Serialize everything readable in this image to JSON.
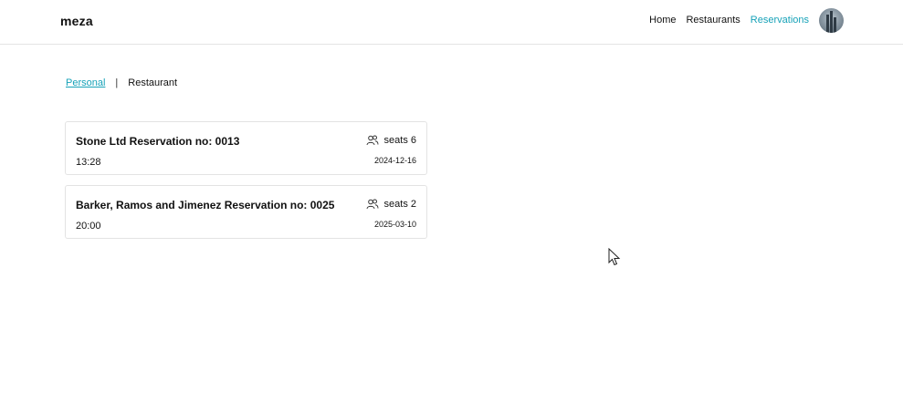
{
  "brand": "meza",
  "nav": {
    "home": "Home",
    "restaurants": "Restaurants",
    "reservations": "Reservations",
    "active": "reservations"
  },
  "tabs": {
    "personal": "Personal",
    "separator": "|",
    "restaurant": "Restaurant",
    "active": "personal"
  },
  "reservations": [
    {
      "title": "Stone Ltd Reservation no: 0013",
      "time": "13:28",
      "seats": "seats 6",
      "date": "2024-12-16"
    },
    {
      "title": "Barker, Ramos and Jimenez Reservation no: 0025",
      "time": "20:00",
      "seats": "seats 2",
      "date": "2025-03-10"
    }
  ],
  "colors": {
    "accent": "#17a2b8",
    "border": "#e3e3e3"
  },
  "icons": {
    "seats": "users-icon",
    "avatar": "user-avatar"
  }
}
